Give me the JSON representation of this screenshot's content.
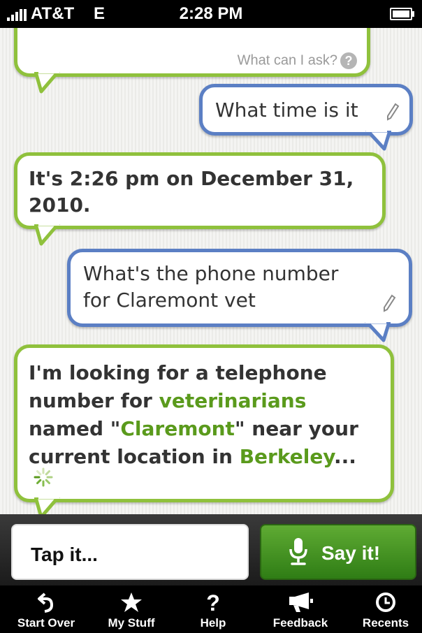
{
  "status_bar": {
    "carrier": "AT&T",
    "network": "E",
    "time": "2:28 PM"
  },
  "conversation": {
    "top_bubble": {
      "link": "What can I ask?",
      "help_glyph": "?"
    },
    "messages": [
      {
        "from": "user",
        "text": "What time is it"
      },
      {
        "from": "assistant",
        "lines": [
          "It's 2:26 pm on December 31,",
          "2010."
        ]
      },
      {
        "from": "user",
        "lines": [
          "What's the phone number",
          "for Claremont vet"
        ]
      },
      {
        "from": "assistant",
        "parts": {
          "l1": "I'm looking for a telephone",
          "l2a": "number for ",
          "l2b": "veterinarians",
          "l3a": "named \"",
          "l3b": "Claremont",
          "l3c": "\" near your",
          "l4a": "current location in ",
          "l4b": "Berkeley",
          "l4c": "..."
        }
      }
    ]
  },
  "input": {
    "tap_label": "Tap it...",
    "say_label": "Say it!"
  },
  "tabs": [
    {
      "label": "Start Over",
      "icon": "undo-arrow-icon"
    },
    {
      "label": "My Stuff",
      "icon": "star-icon"
    },
    {
      "label": "Help",
      "icon": "question-icon"
    },
    {
      "label": "Feedback",
      "icon": "megaphone-icon"
    },
    {
      "label": "Recents",
      "icon": "clock-icon"
    }
  ],
  "colors": {
    "assistant_border": "#8fc13c",
    "user_border": "#5b7fc4",
    "highlight": "#5a9a1c",
    "say_button": "#3f8f1f"
  }
}
